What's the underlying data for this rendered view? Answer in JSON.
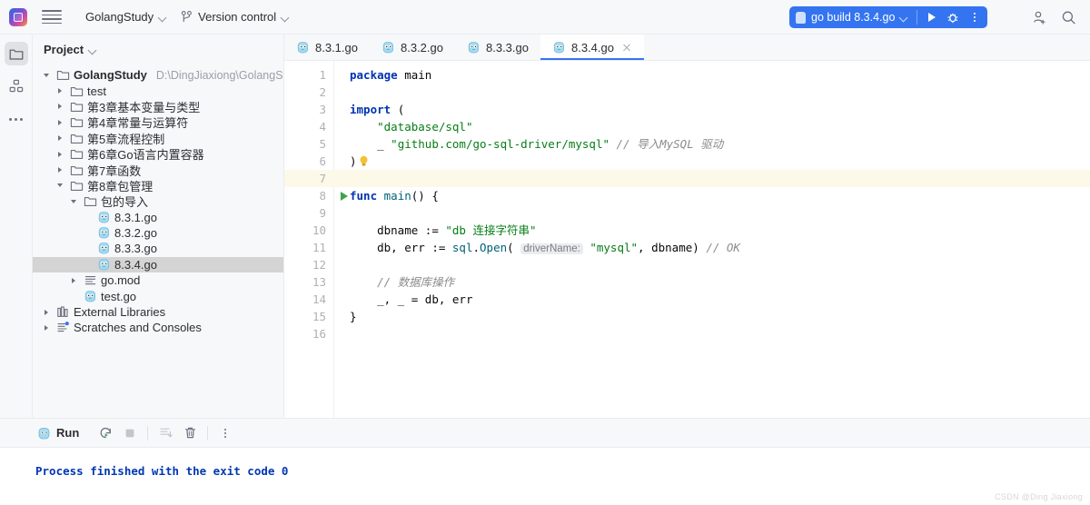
{
  "window": {
    "app_logo": "goland-logo",
    "menu_icon": "hamburger-menu-icon",
    "project_name": "GolangStudy",
    "vcs_label": "Version control",
    "vcs_icon": "branch-icon"
  },
  "run_widget": {
    "config_name": "go build 8.3.4.go",
    "config_icon": "go-file-icon",
    "run_icon": "play-icon",
    "debug_icon": "debug-bug-icon",
    "more_icon": "more-vertical-icon"
  },
  "top_right": {
    "account_icon": "add-account-icon",
    "search_icon": "search-icon"
  },
  "rail": {
    "items": [
      {
        "name": "project-tool-icon",
        "icon": "folder-icon",
        "active": true
      },
      {
        "name": "structure-tool-icon",
        "icon": "grid-blocks-icon",
        "active": false
      },
      {
        "name": "more-tool-windows-icon",
        "icon": "ellipsis-icon",
        "active": false
      }
    ]
  },
  "project_panel": {
    "title": "Project",
    "tree": [
      {
        "label": "GolangStudy",
        "path": "D:\\DingJiaxiong\\GolangStudy",
        "indent": 0,
        "arrow": "open",
        "icon": "folder-icon",
        "bold": true,
        "selected": false
      },
      {
        "label": "test",
        "path": "",
        "indent": 1,
        "arrow": "closed",
        "icon": "folder-icon",
        "bold": false,
        "selected": false
      },
      {
        "label": "第3章基本变量与类型",
        "path": "",
        "indent": 1,
        "arrow": "closed",
        "icon": "folder-icon",
        "bold": false,
        "selected": false
      },
      {
        "label": "第4章常量与运算符",
        "path": "",
        "indent": 1,
        "arrow": "closed",
        "icon": "folder-icon",
        "bold": false,
        "selected": false
      },
      {
        "label": "第5章流程控制",
        "path": "",
        "indent": 1,
        "arrow": "closed",
        "icon": "folder-icon",
        "bold": false,
        "selected": false
      },
      {
        "label": "第6章Go语言内置容器",
        "path": "",
        "indent": 1,
        "arrow": "closed",
        "icon": "folder-icon",
        "bold": false,
        "selected": false
      },
      {
        "label": "第7章函数",
        "path": "",
        "indent": 1,
        "arrow": "closed",
        "icon": "folder-icon",
        "bold": false,
        "selected": false
      },
      {
        "label": "第8章包管理",
        "path": "",
        "indent": 1,
        "arrow": "open",
        "icon": "folder-icon",
        "bold": false,
        "selected": false
      },
      {
        "label": "包的导入",
        "path": "",
        "indent": 2,
        "arrow": "open",
        "icon": "folder-icon",
        "bold": false,
        "selected": false
      },
      {
        "label": "8.3.1.go",
        "path": "",
        "indent": 3,
        "arrow": "none",
        "icon": "go-file-icon",
        "bold": false,
        "selected": false
      },
      {
        "label": "8.3.2.go",
        "path": "",
        "indent": 3,
        "arrow": "none",
        "icon": "go-file-icon",
        "bold": false,
        "selected": false
      },
      {
        "label": "8.3.3.go",
        "path": "",
        "indent": 3,
        "arrow": "none",
        "icon": "go-file-icon",
        "bold": false,
        "selected": false
      },
      {
        "label": "8.3.4.go",
        "path": "",
        "indent": 3,
        "arrow": "none",
        "icon": "go-file-icon",
        "bold": false,
        "selected": true
      },
      {
        "label": "go.mod",
        "path": "",
        "indent": 2,
        "arrow": "closed",
        "icon": "gomod-file-icon",
        "bold": false,
        "selected": false
      },
      {
        "label": "test.go",
        "path": "",
        "indent": 2,
        "arrow": "none",
        "icon": "go-file-icon",
        "bold": false,
        "selected": false
      },
      {
        "label": "External Libraries",
        "path": "",
        "indent": 0,
        "arrow": "closed",
        "icon": "library-icon",
        "bold": false,
        "selected": false
      },
      {
        "label": "Scratches and Consoles",
        "path": "",
        "indent": 0,
        "arrow": "closed",
        "icon": "scratches-icon",
        "bold": false,
        "selected": false
      }
    ]
  },
  "editor": {
    "tabs": [
      {
        "label": "8.3.1.go",
        "icon": "go-file-icon",
        "active": false,
        "closable": false
      },
      {
        "label": "8.3.2.go",
        "icon": "go-file-icon",
        "active": false,
        "closable": false
      },
      {
        "label": "8.3.3.go",
        "icon": "go-file-icon",
        "active": false,
        "closable": false
      },
      {
        "label": "8.3.4.go",
        "icon": "go-file-icon",
        "active": true,
        "closable": true
      }
    ],
    "line_numbers": [
      "1",
      "2",
      "3",
      "4",
      "5",
      "6",
      "7",
      "8",
      "9",
      "10",
      "11",
      "12",
      "13",
      "14",
      "15",
      "16"
    ],
    "highlight_line": 7,
    "run_gutter_line": 8,
    "code_text": [
      "package main",
      "",
      "import (",
      "    \"database/sql\"",
      "    _ \"github.com/go-sql-driver/mysql\" // 导入MySQL 驱动",
      ")",
      "",
      "func main() {",
      "",
      "    dbname := \"db 连接字符串\"",
      "    db, err := sql.Open( driverName: \"mysql\", dbname) // OK",
      "",
      "    // 数据库操作",
      "    _, _ = db, err",
      "}",
      ""
    ],
    "inlay_hint": "driverName:",
    "bulb_icon": "intention-bulb-icon"
  },
  "run_panel": {
    "title": "Run",
    "title_icon": "go-file-icon",
    "buttons": [
      {
        "name": "rerun-button",
        "icon": "rerun-icon"
      },
      {
        "name": "stop-button",
        "icon": "stop-square-icon"
      },
      {
        "name": "scroll-to-end-button",
        "icon": "scroll-end-icon"
      },
      {
        "name": "clear-all-button",
        "icon": "trash-icon"
      },
      {
        "name": "more-options-button",
        "icon": "more-vertical-icon"
      }
    ],
    "console_output": "Process finished with the exit code 0"
  },
  "watermark": "CSDN @Ding Jiaxiong",
  "colors": {
    "accent": "#3574f0",
    "panel_bg": "#f7f8fa",
    "selection": "#d4d4d4",
    "caret_line": "#fcf9e8",
    "keyword": "#0033b3",
    "string": "#067d17",
    "comment": "#8c8c8c",
    "console_text": "#0037b3"
  }
}
